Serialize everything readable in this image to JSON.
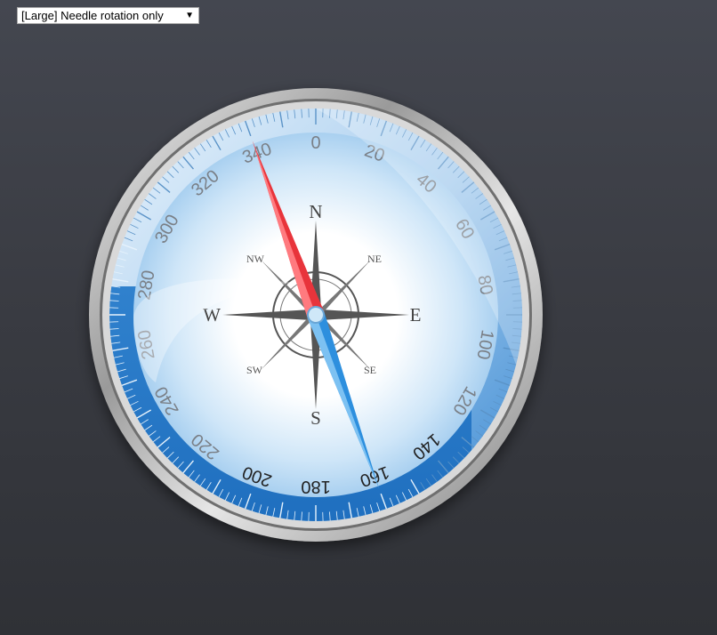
{
  "mode_select": {
    "selected": "[Large] Needle rotation only",
    "arrow_icon": "triangle-down-icon"
  },
  "compass": {
    "heading_deg": 340,
    "rose_labels": {
      "n": "N",
      "e": "E",
      "s": "S",
      "w": "W",
      "ne": "NE",
      "se": "SE",
      "sw": "SW",
      "nw": "NW"
    },
    "dial_numbers": [
      "0",
      "20",
      "40",
      "60",
      "80",
      "100",
      "120",
      "140",
      "160",
      "180",
      "200",
      "220",
      "240",
      "260",
      "280",
      "300",
      "320",
      "340"
    ],
    "colors": {
      "needle_north": "#e8343b",
      "needle_south": "#2d8fde",
      "dial_blue": "#2a7ccc",
      "bezel": "#c9c9c9"
    }
  }
}
